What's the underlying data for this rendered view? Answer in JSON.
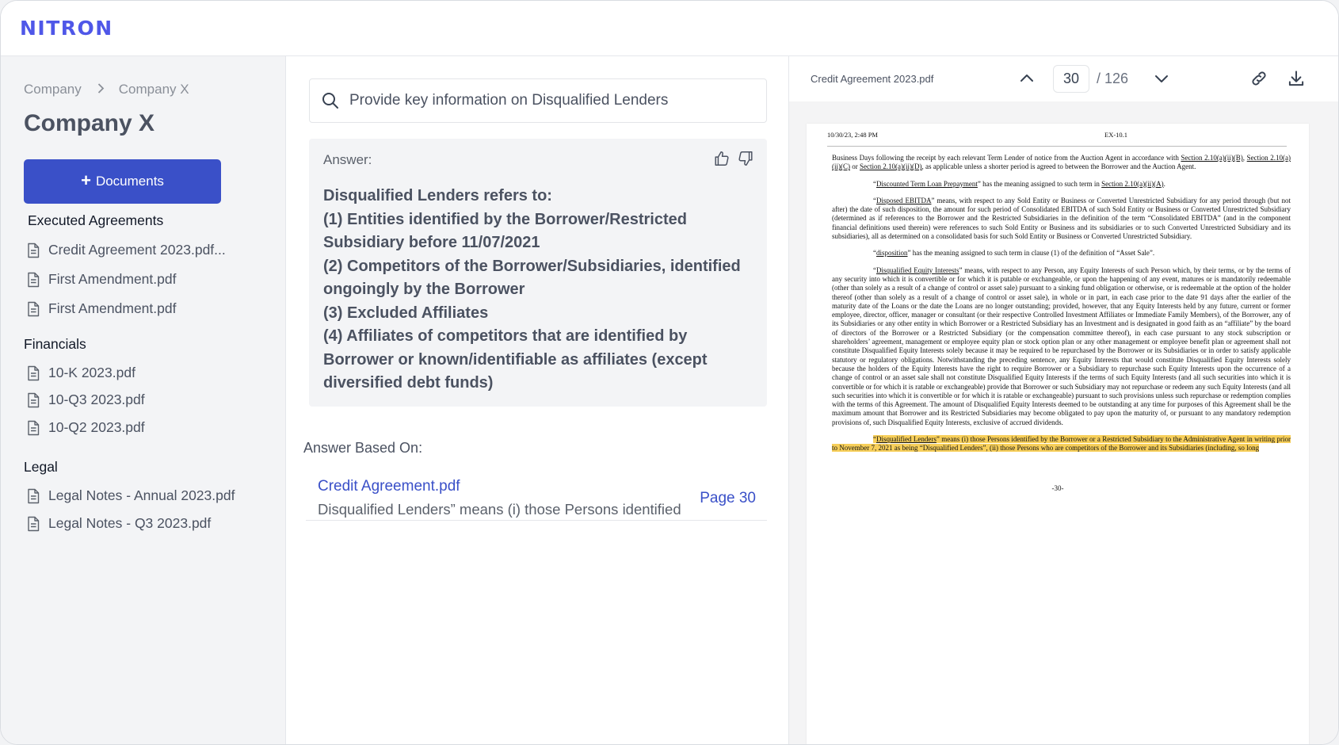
{
  "app": {
    "logo": "NITRON",
    "brand_color": "#4f57e8",
    "accent_color": "#3a50c8"
  },
  "sidebar": {
    "breadcrumb": [
      "Company",
      "Company X"
    ],
    "title": "Company X",
    "add_button_label": "Documents",
    "sections": [
      {
        "heading": "Executed Agreements",
        "files": [
          "Credit Agreement 2023.pdf...",
          "First Amendment.pdf",
          "First Amendment.pdf"
        ]
      },
      {
        "heading": "Financials",
        "files": [
          "10-K 2023.pdf",
          "10-Q3 2023.pdf",
          "10-Q2 2023.pdf"
        ]
      },
      {
        "heading": "Legal",
        "files": [
          "Legal Notes - Annual 2023.pdf",
          "Legal Notes - Q3 2023.pdf"
        ]
      }
    ]
  },
  "search": {
    "value": "Provide key information on Disqualified Lenders",
    "icon": "search-icon"
  },
  "answer": {
    "label": "Answer:",
    "lines": [
      "Disqualified Lenders refers to:",
      "(1) Entities identified by the Borrower/Restricted Subsidiary before 11/07/2021",
      "(2) Competitors of the Borrower/Subsidiaries, identified ongoingly by the Borrower",
      "(3) Excluded Affiliates",
      "(4) Affiliates of competitors that are identified by Borrower or known/identifiable as affiliates (except diversified debt funds)"
    ]
  },
  "sources": {
    "heading": "Answer Based On:",
    "items": [
      {
        "title": "Credit Agreement.pdf",
        "snippet": "Disqualified Lenders” means (i) those Persons identified",
        "page": "Page 30"
      }
    ]
  },
  "viewer": {
    "file_name": "Credit Agreement 2023.pdf",
    "current_page": "30",
    "total_pages": "/ 126",
    "doc": {
      "header_left": "10/30/23, 2:48 PM",
      "header_right": "EX-10.1",
      "p1_a": "Business Days following the receipt by each relevant Term Lender of notice from the Auction Agent in accordance with ",
      "p1_ref1": "Section 2.10(a)(ii)(B)",
      "p1_b": ", ",
      "p1_ref2": "Section 2.10(a)(ii)(C)",
      "p1_c": " or ",
      "p1_ref3": "Section 2.10(a)(ii)(D)",
      "p1_d": ", as applicable unless a shorter period is agreed to between the Borrower and the Auction Agent.",
      "p2_term": "Discounted Term Loan Prepayment",
      "p2_text": "” has the meaning assigned to such term in ",
      "p2_ref": "Section 2.10(a)(ii)(A)",
      "p3_term": "Disposed EBITDA",
      "p3_text": "” means, with respect to any Sold Entity or Business or Converted Unrestricted Subsidiary for any period through (but not after) the date of such disposition, the amount for such period of Consolidated EBITDA of such Sold Entity or Business or Converted Unrestricted Subsidiary (determined as if references to the Borrower and the Restricted Subsidiaries in the definition of the term “Consolidated EBITDA” (and in the component financial definitions used therein) were references to such Sold Entity or Business and its subsidiaries or to such Converted Unrestricted Subsidiary and its subsidiaries), all as determined on a consolidated basis for such Sold Entity or Business or Converted Unrestricted Subsidiary.",
      "p4_term": "disposition",
      "p4_text": "” has the meaning assigned to such term in clause (1) of the definition of “Asset Sale”.",
      "p5_term": "Disqualified Equity Interests",
      "p5_text": "” means, with respect to any Person, any Equity Interests of such Person which, by their terms, or by the terms of any security into which it is convertible or for which it is putable or exchangeable, or upon the happening of any event, matures or is mandatorily redeemable (other than solely as a result of a change of control or asset sale) pursuant to a sinking fund obligation or otherwise, or is redeemable at the option of the holder thereof (other than solely as a result of a change of control or asset sale), in whole or in part, in each case prior to the date 91 days after the earlier of the maturity date of the Loans or the date the Loans are no longer outstanding; provided, however, that any Equity Interests held by any future, current or former employee, director, officer, manager or consultant (or their respective Controlled Investment Affiliates or Immediate Family Members), of the Borrower, any of its Subsidiaries or any other entity in which Borrower or a Restricted Subsidiary has an Investment and is designated in good faith as an “affiliate” by the board of directors of the Borrower or a Restricted Subsidiary (or the compensation committee thereof), in each case pursuant to any stock subscription or shareholders’ agreement, management or employee equity plan or stock option plan or any other management or employee benefit plan or agreement shall not constitute Disqualified Equity Interests solely because it may be required to be repurchased by the Borrower or its Subsidiaries or in order to satisfy applicable statutory or regulatory obligations. Notwithstanding the preceding sentence, any Equity Interests that would constitute Disqualified Equity Interests solely because the holders of the Equity Interests have the right to require Borrower or a Subsidiary to repurchase such Equity Interests upon the occurrence of a change of control or an asset sale shall not constitute Disqualified Equity Interests if the terms of such Equity Interests (and all such securities into which it is convertible or for which it is ratable or exchangeable) provide that Borrower or such Subsidiary may not repurchase or redeem any such Equity Interests (and all such securities into which it is convertible or for which it is ratable or exchangeable) pursuant to such provisions unless such repurchase or redemption complies with the terms of this Agreement. The amount of Disqualified Equity Interests deemed to be outstanding at any time for purposes of this Agreement shall be the maximum amount that Borrower and its Restricted Subsidiaries may become obligated to pay upon the maturity of, or pursuant to any mandatory redemption provisions of, such Disqualified Equity Interests, exclusive of accrued dividends.",
      "p6_term": "Disqualified Lenders",
      "p6_text": "” means (i) those Persons identified by the Borrower or a Restricted Subsidiary to the Administrative Agent in writing prior to November 7, 2021 as being “Disqualified Lenders”, (ii) those Persons who are competitors of the Borrower and its Subsidiaries (including, so long",
      "footer": "-30-"
    }
  }
}
